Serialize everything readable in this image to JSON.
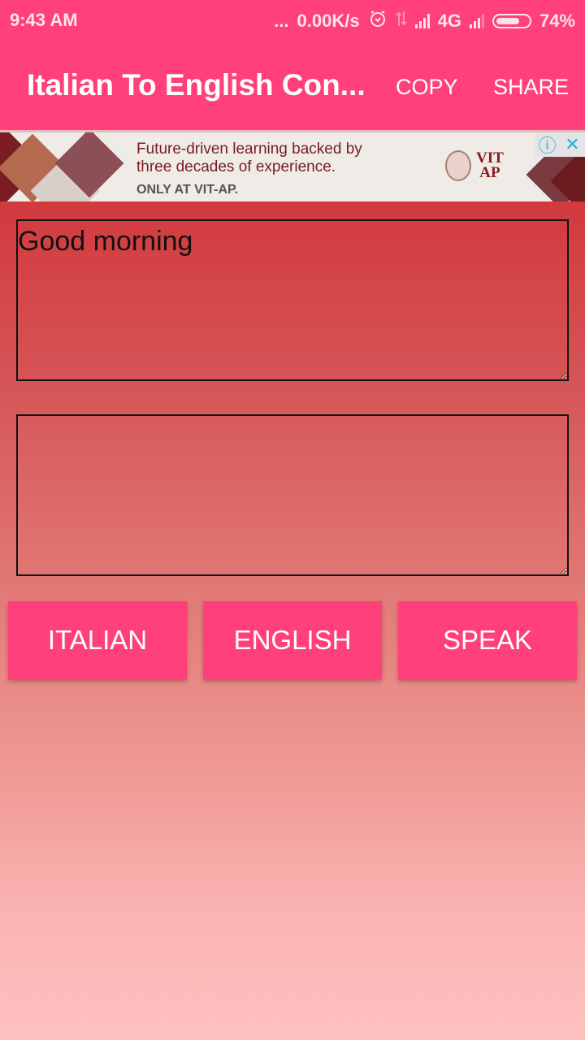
{
  "status_bar": {
    "time": "9:43 AM",
    "dots": "...",
    "net_speed": "0.00K/s",
    "network_type": "4G",
    "battery_percent": "74%",
    "battery_level": 0.74,
    "icons": [
      "alarm-icon",
      "data-arrows-icon",
      "signal-icon",
      "signal-icon",
      "battery-icon"
    ]
  },
  "app_bar": {
    "title": "Italian To English Con...",
    "actions": [
      {
        "label": "COPY"
      },
      {
        "label": "SHARE"
      }
    ]
  },
  "ad": {
    "headline_line1": "Future-driven learning backed by",
    "headline_line2": "three decades of experience.",
    "subline": "ONLY AT VIT-AP.",
    "logo_line1": "VIT",
    "logo_line2": "AP",
    "info_icon": "ⓘ",
    "close_icon": "✕"
  },
  "input": {
    "value": "Good morning",
    "placeholder": ""
  },
  "output": {
    "value": "",
    "placeholder": ""
  },
  "buttons": [
    {
      "label": "ITALIAN"
    },
    {
      "label": "ENGLISH"
    },
    {
      "label": "SPEAK"
    }
  ],
  "colors": {
    "primary": "#ff407a",
    "background_top": "#d23a3e",
    "background_bottom": "#ffc1c1"
  }
}
